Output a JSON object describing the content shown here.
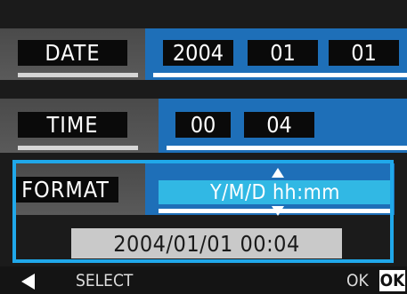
{
  "date_row": {
    "label": "DATE",
    "year": "2004",
    "month": "01",
    "day": "01"
  },
  "time_row": {
    "label": "TIME",
    "hour": "00",
    "minute": "04"
  },
  "format_row": {
    "label": "FORMAT",
    "value": "Y/M/D  hh:mm"
  },
  "preview": {
    "datetime": "2004/01/01  00:04"
  },
  "bottom_bar": {
    "select_label": "SELECT",
    "ok_label": "OK",
    "ok_badge": "OK"
  },
  "icons": {
    "up": "up-arrow-icon",
    "down": "down-arrow-icon",
    "left": "left-arrow-icon"
  },
  "colors": {
    "value_panel": "#1e6fb8",
    "selection": "#20a8ea",
    "format_highlight": "#31b8e4"
  }
}
